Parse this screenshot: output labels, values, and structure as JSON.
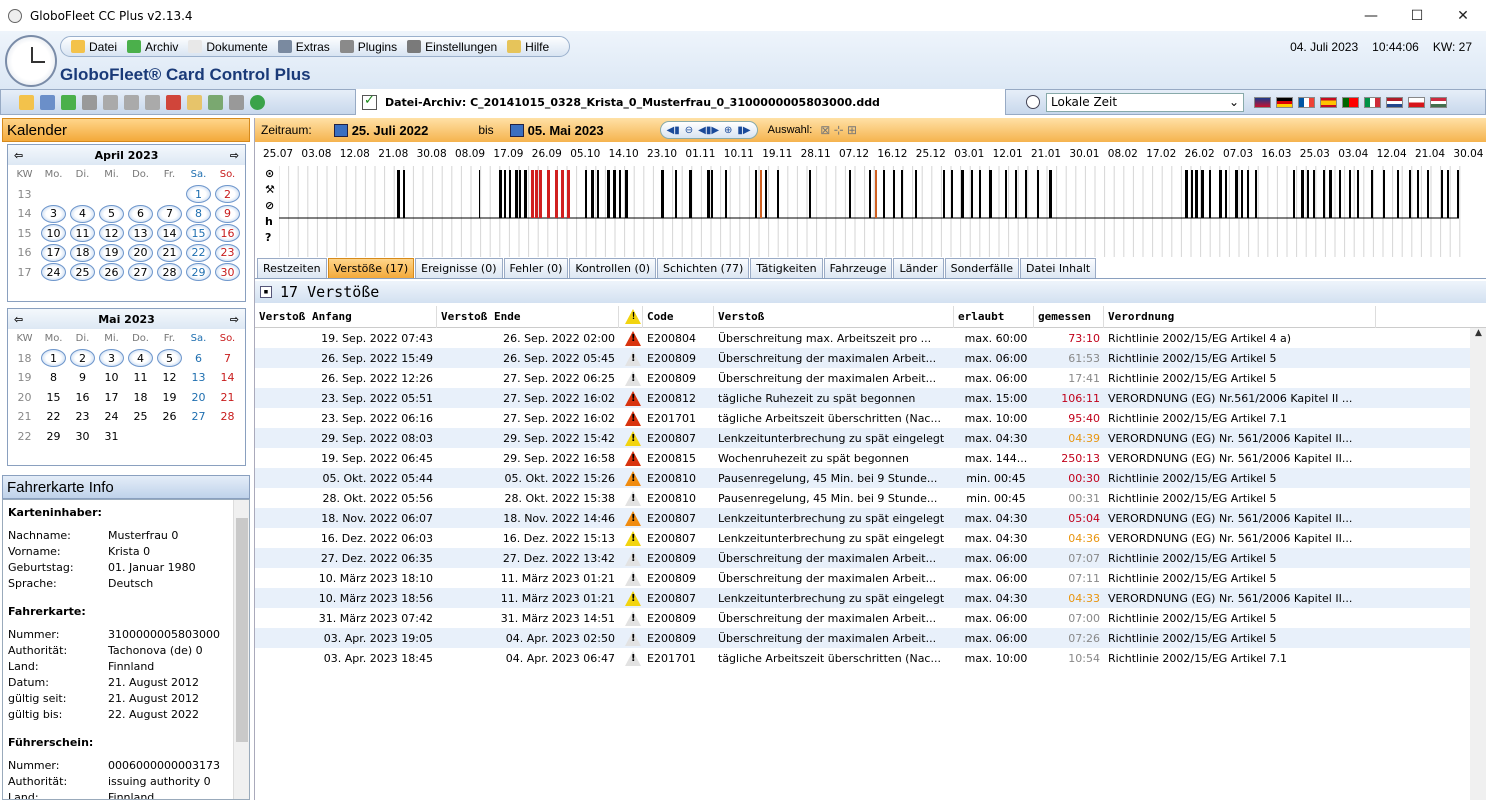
{
  "window": {
    "title": "GloboFleet CC Plus v2.13.4"
  },
  "menu": [
    {
      "label": "Datei",
      "icon": "folder-icon"
    },
    {
      "label": "Archiv",
      "icon": "database-icon"
    },
    {
      "label": "Dokumente",
      "icon": "document-icon"
    },
    {
      "label": "Extras",
      "icon": "calculator-icon"
    },
    {
      "label": "Plugins",
      "icon": "puzzle-icon"
    },
    {
      "label": "Einstellungen",
      "icon": "wrench-icon"
    },
    {
      "label": "Hilfe",
      "icon": "help-icon"
    }
  ],
  "brand": "GloboFleet® Card Control Plus",
  "header": {
    "date": "04. Juli 2023",
    "time": "10:44:06",
    "week": "KW: 27"
  },
  "archive": {
    "label": "Datei-Archiv: C_20141015_0328_Krista_0_Musterfrau_0_3100000005803000.ddd"
  },
  "timezone": {
    "selected": "Lokale Zeit"
  },
  "calendar": {
    "title": "Kalender",
    "headers": [
      "KW",
      "Mo.",
      "Di.",
      "Mi.",
      "Do.",
      "Fr.",
      "Sa.",
      "So."
    ],
    "april": {
      "title": "April 2023",
      "rows": [
        [
          "13",
          "",
          "",
          "",
          "",
          "",
          "1",
          "2"
        ],
        [
          "14",
          "3",
          "4",
          "5",
          "6",
          "7",
          "8",
          "9"
        ],
        [
          "15",
          "10",
          "11",
          "12",
          "13",
          "14",
          "15",
          "16"
        ],
        [
          "16",
          "17",
          "18",
          "19",
          "20",
          "21",
          "22",
          "23"
        ],
        [
          "17",
          "24",
          "25",
          "26",
          "27",
          "28",
          "29",
          "30"
        ]
      ]
    },
    "mai": {
      "title": "Mai 2023",
      "rows": [
        [
          "18",
          "1",
          "2",
          "3",
          "4",
          "5",
          "6",
          "7"
        ],
        [
          "19",
          "8",
          "9",
          "10",
          "11",
          "12",
          "13",
          "14"
        ],
        [
          "20",
          "15",
          "16",
          "17",
          "18",
          "19",
          "20",
          "21"
        ],
        [
          "21",
          "22",
          "23",
          "24",
          "25",
          "26",
          "27",
          "28"
        ],
        [
          "22",
          "29",
          "30",
          "31",
          "",
          "",
          "",
          ""
        ]
      ]
    }
  },
  "info": {
    "title": "Fahrerkarte Info",
    "sections": [
      {
        "title": "Karteninhaber:",
        "rows": [
          [
            "Nachname:",
            "Musterfrau 0"
          ],
          [
            "Vorname:",
            "Krista 0"
          ],
          [
            "Geburtstag:",
            "01. Januar 1980"
          ],
          [
            "Sprache:",
            "Deutsch"
          ]
        ]
      },
      {
        "title": "Fahrerkarte:",
        "rows": [
          [
            "Nummer:",
            "3100000005803000"
          ],
          [
            "Authorität:",
            "Tachonova (de) 0"
          ],
          [
            "Land:",
            "Finnland"
          ],
          [
            "Datum:",
            "21. August 2012"
          ],
          [
            "gültig seit:",
            "21. August 2012"
          ],
          [
            "gültig bis:",
            "22. August 2022"
          ]
        ]
      },
      {
        "title": "Führerschein:",
        "rows": [
          [
            "Nummer:",
            "0006000000003173"
          ],
          [
            "Authorität:",
            "issuing authority 0"
          ],
          [
            "Land:",
            "Finnland"
          ]
        ]
      }
    ]
  },
  "period": {
    "label": "Zeitraum:",
    "from": "25. Juli 2022",
    "bis": "bis",
    "to": "05. Mai 2023",
    "auswahl": "Auswahl:"
  },
  "timeline": {
    "dates": [
      "25.07",
      "03.08",
      "12.08",
      "21.08",
      "30.08",
      "08.09",
      "17.09",
      "26.09",
      "05.10",
      "14.10",
      "23.10",
      "01.11",
      "10.11",
      "19.11",
      "28.11",
      "07.12",
      "16.12",
      "25.12",
      "03.01",
      "12.01",
      "21.01",
      "30.01",
      "08.02",
      "17.02",
      "26.02",
      "07.03",
      "16.03",
      "25.03",
      "03.04",
      "12.04",
      "21.04",
      "30.04"
    ],
    "row_labels": [
      "⊙",
      "⚒",
      "⊘",
      "h",
      "?"
    ]
  },
  "tabs": [
    "Restzeiten",
    "Verstöße (17)",
    "Ereignisse (0)",
    "Fehler (0)",
    "Kontrollen (0)",
    "Schichten (77)",
    "Tätigkeiten",
    "Fahrzeuge",
    "Länder",
    "Sonderfälle",
    "Datei Inhalt"
  ],
  "active_tab": 1,
  "violations": {
    "heading": "17 Verstöße",
    "columns": [
      "Verstoß Anfang",
      "Verstoß Ende",
      "",
      "Code",
      "Verstoß",
      "erlaubt",
      "gemessen",
      "Verordnung"
    ],
    "rows": [
      {
        "start": "19. Sep. 2022 07:43",
        "end": "26. Sep. 2022 02:00",
        "level": "red",
        "code": "E200804",
        "text": "Überschreitung max. Arbeitszeit pro ...",
        "allowed": "max. 60:00",
        "measured": "73:10",
        "mcolor": "red",
        "reg": "Richtlinie 2002/15/EG Artikel 4 a)"
      },
      {
        "start": "26. Sep. 2022 15:49",
        "end": "26. Sep. 2022 05:45",
        "level": "white",
        "code": "E200809",
        "text": "Überschreitung der maximalen Arbeit...",
        "allowed": "max. 06:00",
        "measured": "61:53",
        "mcolor": "gray",
        "reg": "Richtlinie 2002/15/EG Artikel 5"
      },
      {
        "start": "26. Sep. 2022 12:26",
        "end": "27. Sep. 2022 06:25",
        "level": "white",
        "code": "E200809",
        "text": "Überschreitung der maximalen Arbeit...",
        "allowed": "max. 06:00",
        "measured": "17:41",
        "mcolor": "gray",
        "reg": "Richtlinie 2002/15/EG Artikel 5"
      },
      {
        "start": "23. Sep. 2022 05:51",
        "end": "27. Sep. 2022 16:02",
        "level": "red",
        "code": "E200812",
        "text": "tägliche Ruhezeit zu spät begonnen",
        "allowed": "max. 15:00",
        "measured": "106:11",
        "mcolor": "red",
        "reg": "VERORDNUNG (EG) Nr.561/2006 Kapitel II ..."
      },
      {
        "start": "23. Sep. 2022 06:16",
        "end": "27. Sep. 2022 16:02",
        "level": "red",
        "code": "E201701",
        "text": "tägliche Arbeitszeit überschritten (Nac...",
        "allowed": "max. 10:00",
        "measured": "95:40",
        "mcolor": "red",
        "reg": "Richtlinie 2002/15/EG Artikel 7.1"
      },
      {
        "start": "29. Sep. 2022 08:03",
        "end": "29. Sep. 2022 15:42",
        "level": "yellow",
        "code": "E200807",
        "text": "Lenkzeitunterbrechung zu spät eingelegt",
        "allowed": "max. 04:30",
        "measured": "04:39",
        "mcolor": "orange",
        "reg": "VERORDNUNG (EG) Nr. 561/2006 Kapitel II..."
      },
      {
        "start": "19. Sep. 2022 06:45",
        "end": "29. Sep. 2022 16:58",
        "level": "red",
        "code": "E200815",
        "text": "Wochenruhezeit zu spät begonnen",
        "allowed": "max. 144...",
        "measured": "250:13",
        "mcolor": "red",
        "reg": "VERORDNUNG (EG) Nr. 561/2006 Kapitel II..."
      },
      {
        "start": "05. Okt. 2022 05:44",
        "end": "05. Okt. 2022 15:26",
        "level": "orange",
        "code": "E200810",
        "text": "Pausenregelung, 45 Min. bei 9 Stunde...",
        "allowed": "min. 00:45",
        "measured": "00:30",
        "mcolor": "red",
        "reg": "Richtlinie 2002/15/EG Artikel 5"
      },
      {
        "start": "28. Okt. 2022 05:56",
        "end": "28. Okt. 2022 15:38",
        "level": "white",
        "code": "E200810",
        "text": "Pausenregelung, 45 Min. bei 9 Stunde...",
        "allowed": "min. 00:45",
        "measured": "00:31",
        "mcolor": "gray",
        "reg": "Richtlinie 2002/15/EG Artikel 5"
      },
      {
        "start": "18. Nov. 2022 06:07",
        "end": "18. Nov. 2022 14:46",
        "level": "orange",
        "code": "E200807",
        "text": "Lenkzeitunterbrechung zu spät eingelegt",
        "allowed": "max. 04:30",
        "measured": "05:04",
        "mcolor": "red",
        "reg": "VERORDNUNG (EG) Nr. 561/2006 Kapitel II..."
      },
      {
        "start": "16. Dez. 2022 06:03",
        "end": "16. Dez. 2022 15:13",
        "level": "yellow",
        "code": "E200807",
        "text": "Lenkzeitunterbrechung zu spät eingelegt",
        "allowed": "max. 04:30",
        "measured": "04:36",
        "mcolor": "orange",
        "reg": "VERORDNUNG (EG) Nr. 561/2006 Kapitel II..."
      },
      {
        "start": "27. Dez. 2022 06:35",
        "end": "27. Dez. 2022 13:42",
        "level": "white",
        "code": "E200809",
        "text": "Überschreitung der maximalen Arbeit...",
        "allowed": "max. 06:00",
        "measured": "07:07",
        "mcolor": "gray",
        "reg": "Richtlinie 2002/15/EG Artikel 5"
      },
      {
        "start": "10. März 2023 18:10",
        "end": "11. März 2023 01:21",
        "level": "white",
        "code": "E200809",
        "text": "Überschreitung der maximalen Arbeit...",
        "allowed": "max. 06:00",
        "measured": "07:11",
        "mcolor": "gray",
        "reg": "Richtlinie 2002/15/EG Artikel 5"
      },
      {
        "start": "10. März 2023 18:56",
        "end": "11. März 2023 01:21",
        "level": "yellow",
        "code": "E200807",
        "text": "Lenkzeitunterbrechung zu spät eingelegt",
        "allowed": "max. 04:30",
        "measured": "04:33",
        "mcolor": "orange",
        "reg": "VERORDNUNG (EG) Nr. 561/2006 Kapitel II..."
      },
      {
        "start": "31. März 2023 07:42",
        "end": "31. März 2023 14:51",
        "level": "white",
        "code": "E200809",
        "text": "Überschreitung der maximalen Arbeit...",
        "allowed": "max. 06:00",
        "measured": "07:00",
        "mcolor": "gray",
        "reg": "Richtlinie 2002/15/EG Artikel 5"
      },
      {
        "start": "03. Apr. 2023 19:05",
        "end": "04. Apr. 2023 02:50",
        "level": "white",
        "code": "E200809",
        "text": "Überschreitung der maximalen Arbeit...",
        "allowed": "max. 06:00",
        "measured": "07:26",
        "mcolor": "gray",
        "reg": "Richtlinie 2002/15/EG Artikel 5"
      },
      {
        "start": "03. Apr. 2023 18:45",
        "end": "04. Apr. 2023 06:47",
        "level": "white",
        "code": "E201701",
        "text": "tägliche Arbeitszeit überschritten (Nac...",
        "allowed": "max. 10:00",
        "measured": "10:54",
        "mcolor": "gray",
        "reg": "Richtlinie 2002/15/EG Artikel 7.1"
      }
    ]
  }
}
